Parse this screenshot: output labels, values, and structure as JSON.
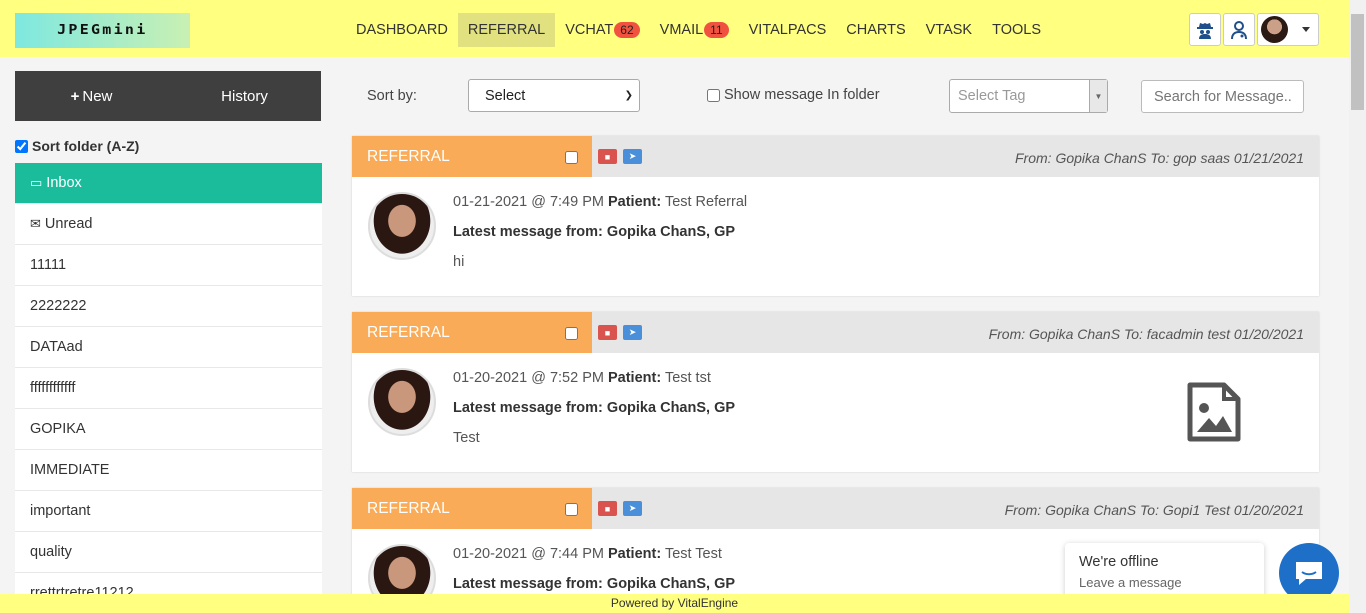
{
  "app": {
    "logo_text": "JPEGmini"
  },
  "nav": {
    "items": [
      {
        "label": "DASHBOARD"
      },
      {
        "label": "REFERRAL"
      },
      {
        "label": "VCHAT",
        "badge": "62"
      },
      {
        "label": "VMAIL",
        "badge": "11"
      },
      {
        "label": "VITALPACS"
      },
      {
        "label": "CHARTS"
      },
      {
        "label": "VTASK"
      },
      {
        "label": "TOOLS"
      }
    ],
    "active": "REFERRAL"
  },
  "sidebar": {
    "new_label": "New",
    "history_label": "History",
    "sort_folder_label": "Sort folder (A-Z)",
    "folders": [
      {
        "label": "Inbox"
      },
      {
        "label": "Unread"
      },
      {
        "label": "11111"
      },
      {
        "label": "2222222"
      },
      {
        "label": "DATAad"
      },
      {
        "label": "ffffffffffff"
      },
      {
        "label": "GOPIKA"
      },
      {
        "label": "IMMEDIATE"
      },
      {
        "label": "important"
      },
      {
        "label": "quality"
      },
      {
        "label": "rrettrtretre11212"
      }
    ]
  },
  "filters": {
    "sort_by_label": "Sort by:",
    "sort_value": "Select",
    "show_in_folder_label": "Show message In folder",
    "tag_placeholder": "Select Tag",
    "search_placeholder": "Search for Message.."
  },
  "messages": [
    {
      "tag": "REFERRAL",
      "from_line": "From: Gopika ChanS To: gop saas 01/21/2021",
      "datetime": "01-21-2021 @ 7:49 PM",
      "patient_label": "Patient:",
      "patient": "Test Referral",
      "latest_label": "Latest message from: Gopika ChanS, GP",
      "body": "hi"
    },
    {
      "tag": "REFERRAL",
      "from_line": "From: Gopika ChanS To: facadmin test 01/20/2021",
      "datetime": "01-20-2021 @ 7:52 PM",
      "patient_label": "Patient:",
      "patient": "Test tst",
      "latest_label": "Latest message from: Gopika ChanS, GP",
      "body": "Test"
    },
    {
      "tag": "REFERRAL",
      "from_line": "From: Gopika ChanS To: Gopi1 Test 01/20/2021",
      "datetime": "01-20-2021 @ 7:44 PM",
      "patient_label": "Patient:",
      "patient": "Test Test",
      "latest_label": "Latest message from: Gopika ChanS, GP",
      "body": ""
    }
  ],
  "chat_widget": {
    "title": "We're offline",
    "subtitle": "Leave a message"
  },
  "footer": {
    "text": "Powered by VitalEngine"
  },
  "colors": {
    "topbar": "#ffff80",
    "active_folder": "#1abc9c",
    "tag": "#f9ab57",
    "badge": "#f0523f",
    "chat": "#1e6fc8"
  }
}
